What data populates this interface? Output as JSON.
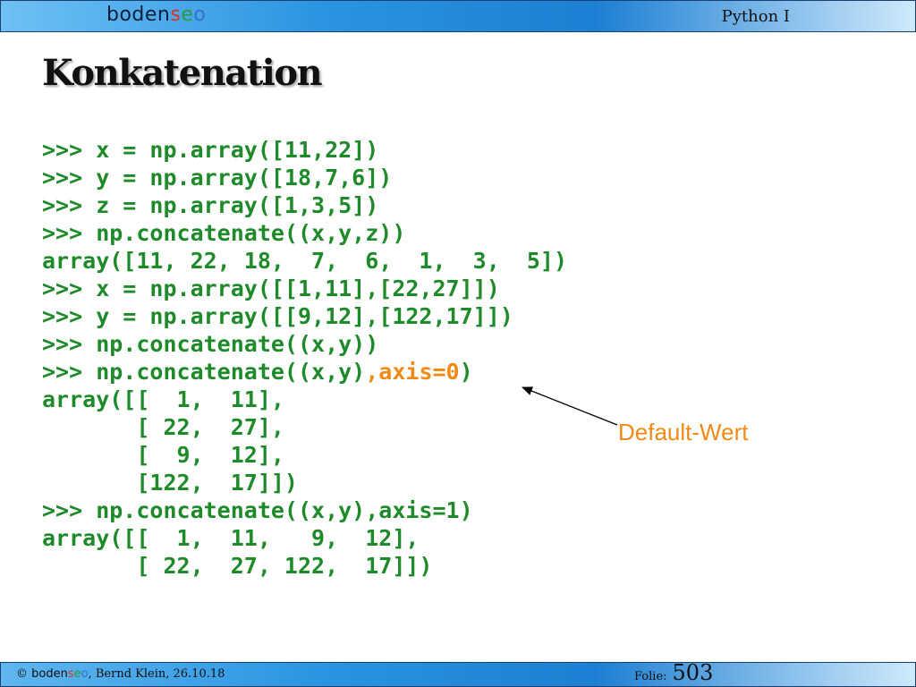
{
  "header": {
    "logo_main": "bodens",
    "logo_s": "s",
    "logo_e": "e",
    "logo_o": "o",
    "logo_prefix": "boden",
    "course": "Python I"
  },
  "slide": {
    "title": "Konkatenation",
    "code_lines": [
      {
        "text": ">>> x = np.array([11,22])"
      },
      {
        "text": ">>> y = np.array([18,7,6])"
      },
      {
        "text": ">>> z = np.array([1,3,5])"
      },
      {
        "text": ">>> np.concatenate((x,y,z))"
      },
      {
        "text": "array([11, 22, 18,  7,  6,  1,  3,  5])"
      },
      {
        "text": ">>> x = np.array([[1,11],[22,27]])"
      },
      {
        "text": ">>> y = np.array([[9,12],[122,17]])"
      },
      {
        "text": ">>> np.concatenate((x,y))"
      },
      {
        "text": ">>> np.concatenate((x,y)",
        "highlight": ",axis=0",
        "tail": ")"
      },
      {
        "text": "array([[  1,  11],"
      },
      {
        "text": "       [ 22,  27],"
      },
      {
        "text": "       [  9,  12],"
      },
      {
        "text": "       [122,  17]])"
      },
      {
        "text": ">>> np.concatenate((x,y),axis=1)"
      },
      {
        "text": "array([[  1,  11,   9,  12],"
      },
      {
        "text": "       [ 22,  27, 122,  17]])"
      }
    ],
    "annotation": "Default-Wert",
    "colors": {
      "code": "#1e8a2a",
      "highlight": "#f08a16"
    }
  },
  "footer": {
    "copyright": "©",
    "logo_prefix": "boden",
    "logo_s": "s",
    "logo_e": "e",
    "logo_o": "o",
    "author_date": ", Bernd Klein, 26.10.18",
    "folio_label": "Folie:",
    "folio_number": "503"
  }
}
